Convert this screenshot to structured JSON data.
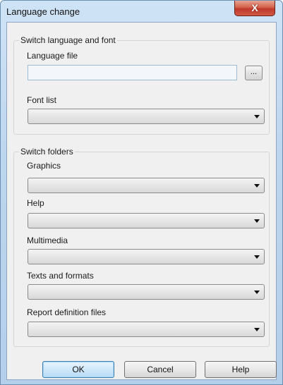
{
  "window": {
    "title": "Language change",
    "close_glyph": "X"
  },
  "group_language": {
    "title": "Switch language and font",
    "language_file_label": "Language file",
    "language_file_value": "",
    "browse_label": "...",
    "font_list_label": "Font list",
    "font_list_value": ""
  },
  "group_folders": {
    "title": "Switch folders",
    "fields": [
      {
        "label": "Graphics",
        "value": ""
      },
      {
        "label": "Help",
        "value": ""
      },
      {
        "label": "Multimedia",
        "value": ""
      },
      {
        "label": "Texts and formats",
        "value": ""
      },
      {
        "label": "Report definition files",
        "value": ""
      }
    ]
  },
  "buttons": {
    "ok": "OK",
    "cancel": "Cancel",
    "help": "Help"
  },
  "icons": {
    "dropdown": "chevron-down-icon",
    "close": "close-icon"
  },
  "colors": {
    "titlebar": "#bdd6ef",
    "close_button": "#c0392b",
    "default_button": "#cfe8fa"
  }
}
